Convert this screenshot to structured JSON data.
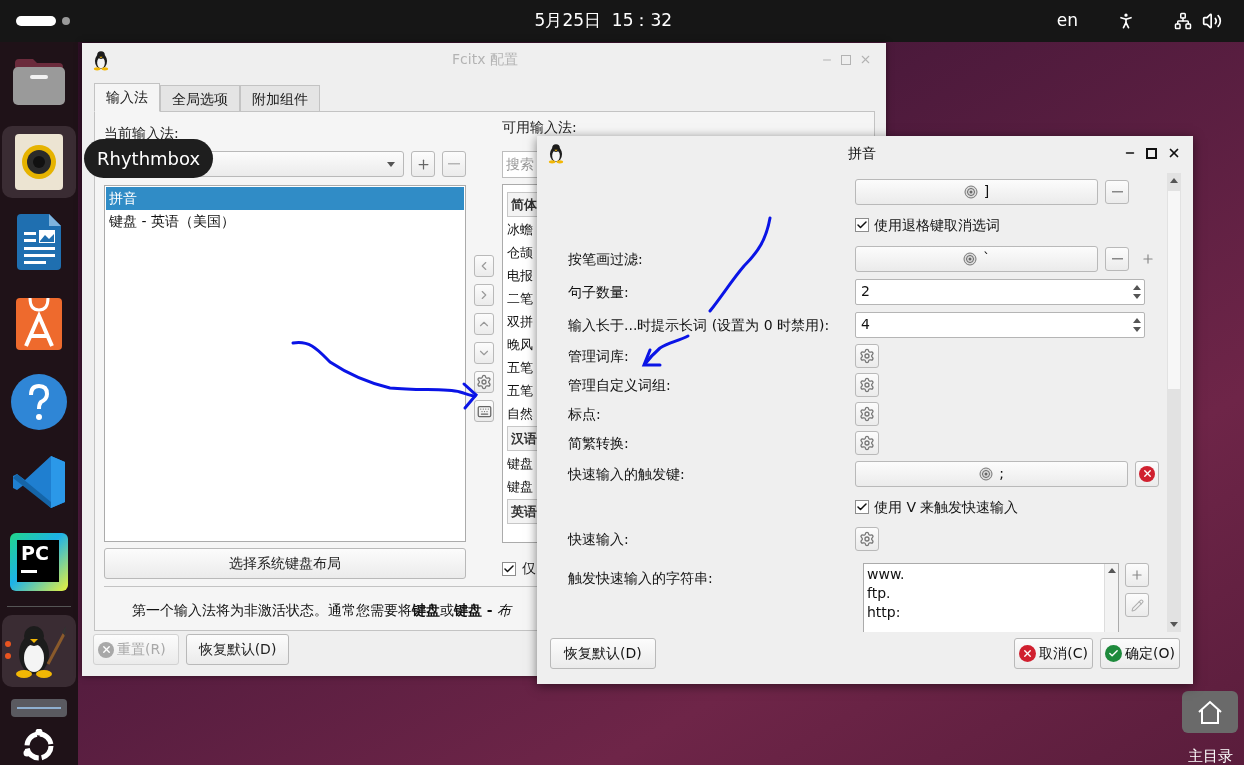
{
  "top_bar": {
    "clock": "5月25日  15：32",
    "input_language": "en"
  },
  "dock": {
    "items": [
      {
        "kind": "files",
        "highlighted": false,
        "running": false
      },
      {
        "kind": "music",
        "highlighted": true,
        "running": false
      },
      {
        "kind": "writer",
        "highlighted": false,
        "running": false
      },
      {
        "kind": "app_center",
        "highlighted": false,
        "running": false
      },
      {
        "kind": "help",
        "highlighted": false,
        "running": false
      },
      {
        "kind": "code_editor",
        "highlighted": false,
        "running": false
      },
      {
        "kind": "pycharm",
        "label": "PC",
        "highlighted": false,
        "running": false
      },
      {
        "kind": "separator"
      },
      {
        "kind": "fcitx",
        "highlighted": true,
        "running": true
      },
      {
        "kind": "drive",
        "highlighted": false,
        "running": false
      },
      {
        "kind": "ubuntu",
        "highlighted": false,
        "running": false
      }
    ]
  },
  "tooltip": "Rhythmbox",
  "desktop_icon": {
    "label": "主目录"
  },
  "config_window": {
    "title": "Fcitx 配置",
    "tabs": [
      {
        "label": "输入法",
        "selected": true
      },
      {
        "label": "全局选项",
        "selected": false
      },
      {
        "label": "附加组件",
        "selected": false
      }
    ],
    "current_label": "当前输入法:",
    "current_buttons": [
      {
        "kind": "add",
        "disabled": false
      },
      {
        "kind": "remove",
        "disabled": true
      }
    ],
    "current_list": [
      {
        "label": "拼音",
        "selected": true
      },
      {
        "label": "键盘 - 英语（美国）",
        "selected": false
      }
    ],
    "layout_button": "选择系统键盘布局",
    "move_buttons": [
      {
        "kind": "left"
      },
      {
        "kind": "right"
      },
      {
        "kind": "up"
      },
      {
        "kind": "down"
      },
      {
        "kind": "configure"
      },
      {
        "kind": "keyboard"
      }
    ],
    "available_label": "可用输入法:",
    "search_placeholder": "搜索",
    "available_list": [
      {
        "kind": "group",
        "label": "简体"
      },
      {
        "kind": "item",
        "label": "冰蟾"
      },
      {
        "kind": "item",
        "label": "仓颉"
      },
      {
        "kind": "item",
        "label": "电报"
      },
      {
        "kind": "item",
        "label": "二笔"
      },
      {
        "kind": "item",
        "label": "双拼"
      },
      {
        "kind": "item",
        "label": "晚风"
      },
      {
        "kind": "item",
        "label": "五笔"
      },
      {
        "kind": "item",
        "label": "五笔"
      },
      {
        "kind": "item",
        "label": "自然"
      },
      {
        "kind": "group",
        "label": "汉语"
      },
      {
        "kind": "item",
        "label": "键盘"
      },
      {
        "kind": "item",
        "label": "键盘"
      },
      {
        "kind": "group",
        "label": "英语"
      }
    ],
    "only_checkbox": {
      "label": "仅",
      "checked": true
    },
    "hint": "第一个输入法将为非激活状态。通常您需要将**键盘**或**键盘 -** *布*",
    "buttons": [
      {
        "label": "重置(R)",
        "kind": "reset",
        "disabled": true
      },
      {
        "label": "恢复默认(D)",
        "kind": "plain",
        "disabled": false
      }
    ]
  },
  "pinyin_dialog": {
    "title": "拼音",
    "rows": [
      {
        "kind": "key",
        "key": "]",
        "buttons": [
          {
            "kind": "remove"
          }
        ]
      },
      {
        "kind": "checkbox",
        "label": "使用退格键取消选词",
        "checked": true
      },
      {
        "kind": "key",
        "label": "按笔画过滤:",
        "key": "`",
        "buttons": [
          {
            "kind": "remove"
          },
          {
            "kind": "add"
          }
        ]
      },
      {
        "kind": "spin",
        "label": "句子数量:",
        "value": "2"
      },
      {
        "kind": "spin",
        "label": "输入长于...时提示长词 (设置为 0 时禁用):",
        "value": "4"
      },
      {
        "kind": "gear",
        "label": "管理词库:"
      },
      {
        "kind": "gear",
        "label": "管理自定义词组:"
      },
      {
        "kind": "gear",
        "label": "标点:"
      },
      {
        "kind": "gear",
        "label": "简繁转换:"
      },
      {
        "kind": "key",
        "label": "快速输入的触发键:",
        "key": ";",
        "buttons": [
          {
            "kind": "clear"
          }
        ]
      },
      {
        "kind": "checkbox",
        "label": "使用 V 来触发快速输入",
        "checked": true
      },
      {
        "kind": "gear",
        "label": "快速输入:"
      },
      {
        "kind": "strings",
        "label": "触发快速输入的字符串:",
        "values": [
          "www.",
          "ftp.",
          "http:"
        ],
        "buttons": [
          {
            "kind": "add"
          },
          {
            "kind": "edit"
          }
        ]
      }
    ],
    "buttons": [
      {
        "label": "恢复默认(D)",
        "kind": "plain"
      },
      {
        "label": "取消(C)",
        "kind": "cancel"
      },
      {
        "label": "确定(O)",
        "kind": "ok"
      }
    ]
  }
}
